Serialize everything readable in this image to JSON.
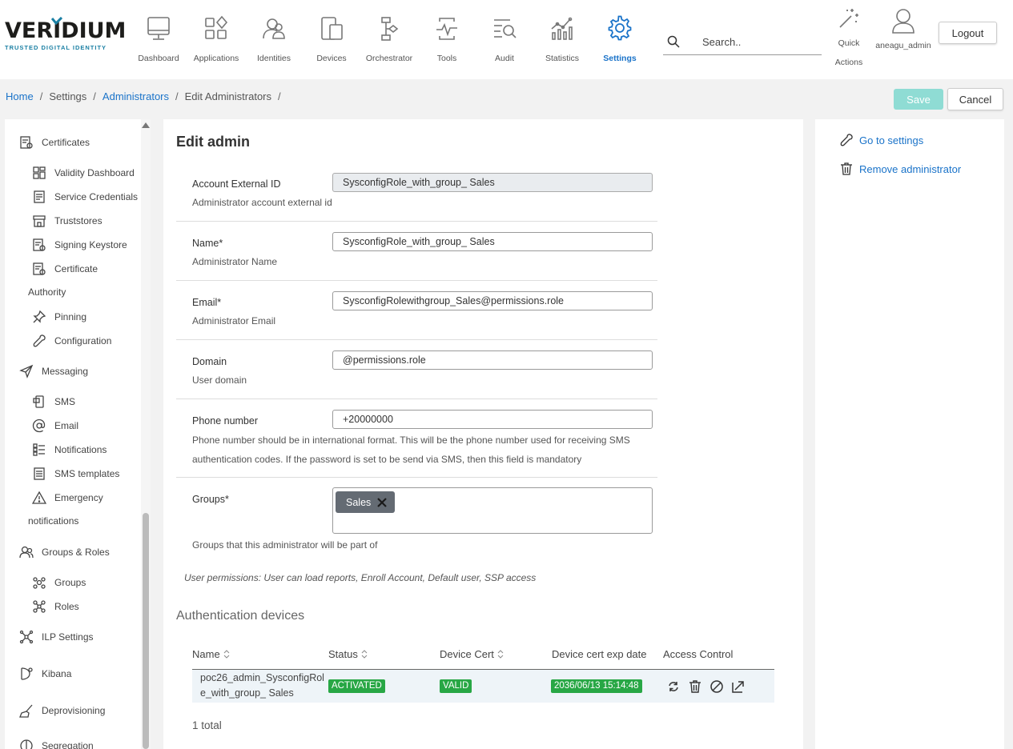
{
  "brand": {
    "name": "VERIDIUM",
    "tagline": "TRUSTED DIGITAL IDENTITY",
    "accent": "#1a7fa3"
  },
  "nav": {
    "items": [
      {
        "label": "Dashboard",
        "icon": "monitor-icon"
      },
      {
        "label": "Applications",
        "icon": "apps-grid-icon"
      },
      {
        "label": "Identities",
        "icon": "identities-icon"
      },
      {
        "label": "Devices",
        "icon": "devices-icon"
      },
      {
        "label": "Orchestrator",
        "icon": "orchestrator-icon"
      },
      {
        "label": "Tools",
        "icon": "tools-icon"
      },
      {
        "label": "Audit",
        "icon": "audit-icon"
      },
      {
        "label": "Statistics",
        "icon": "statistics-icon"
      },
      {
        "label": "Settings",
        "icon": "gear-icon"
      }
    ],
    "active": "Settings",
    "active_color": "#1a73c9"
  },
  "search": {
    "placeholder": "Search.."
  },
  "quick_actions": {
    "line1": "Quick",
    "line2": "Actions"
  },
  "user": {
    "name": "aneagu_admin"
  },
  "logout_label": "Logout",
  "breadcrumb": {
    "home": "Home",
    "settings": "Settings",
    "administrators": "Administrators",
    "edit": "Edit Administrators",
    "sep": "/"
  },
  "actions": {
    "save": "Save",
    "cancel": "Cancel"
  },
  "sidebar": {
    "certificates": "Certificates",
    "validity_dashboard": "Validity Dashboard",
    "service_credentials": "Service Credentials",
    "truststores": "Truststores",
    "signing_keystore": "Signing Keystore",
    "certificate_authority_1": "Certificate",
    "certificate_authority_2": "Authority",
    "pinning": "Pinning",
    "configuration": "Configuration",
    "messaging": "Messaging",
    "sms": "SMS",
    "email": "Email",
    "notifications": "Notifications",
    "sms_templates": "SMS templates",
    "emergency_1": "Emergency",
    "emergency_2": "notifications",
    "groups_roles": "Groups & Roles",
    "groups": "Groups",
    "roles": "Roles",
    "ilp_settings": "ILP Settings",
    "kibana": "Kibana",
    "deprovisioning": "Deprovisioning",
    "segregation": "Segregation"
  },
  "form": {
    "title": "Edit admin",
    "account_id": {
      "label": "Account External ID",
      "value": "SysconfigRole_with_group_ Sales",
      "help": "Administrator account external id"
    },
    "name": {
      "label": "Name*",
      "value": "SysconfigRole_with_group_ Sales",
      "help": "Administrator Name"
    },
    "email": {
      "label": "Email*",
      "value": "SysconfigRolewithgroup_Sales@permissions.role",
      "help": "Administrator Email"
    },
    "domain": {
      "label": "Domain",
      "value": "@permissions.role",
      "help": "User domain"
    },
    "phone": {
      "label": "Phone number",
      "value": "+20000000",
      "help_1": "Phone number should be in international format. This will be the phone number used for receiving SMS",
      "help_2": "authentication codes. If the password is set to be send via SMS, then this field is mandatory"
    },
    "groups": {
      "label": "Groups*",
      "chips": [
        "Sales"
      ],
      "help": "Groups that this administrator will be part of"
    },
    "permissions": "User permissions: User can load reports, Enroll Account, Default user, SSP access"
  },
  "devices": {
    "title": "Authentication devices",
    "columns": {
      "name": "Name",
      "status": "Status",
      "device_cert": "Device Cert",
      "exp_date": "Device cert exp date",
      "access": "Access Control"
    },
    "rows": [
      {
        "name": "poc26_admin_SysconfigRole_with_group_ Sales",
        "status": "ACTIVATED",
        "device_cert": "VALID",
        "exp_date": "2036/06/13 15:14:48"
      }
    ],
    "total": "1 total",
    "badge_color": "#28a745"
  },
  "right_panel": {
    "go_to_settings": "Go to settings",
    "remove_admin": "Remove administrator"
  }
}
